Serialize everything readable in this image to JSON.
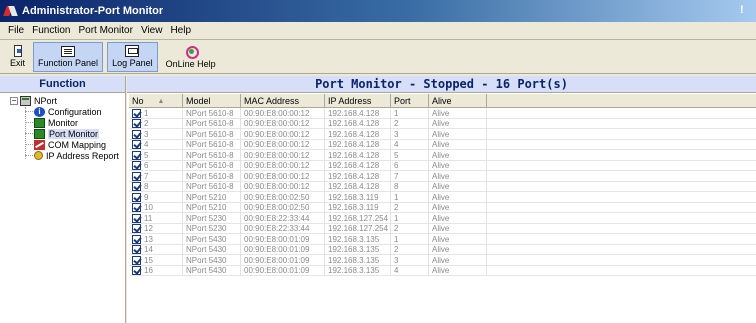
{
  "window": {
    "title": "Administrator-Port Monitor"
  },
  "menu": {
    "file": "File",
    "function": "Function",
    "port_monitor": "Port Monitor",
    "view": "View",
    "help": "Help"
  },
  "toolbar": {
    "exit": "Exit",
    "function_panel": "Function Panel",
    "log_panel": "Log Panel",
    "online_help": "OnLine Help"
  },
  "left_panel": {
    "header": "Function",
    "root": "NPort",
    "items": [
      {
        "label": "Configuration",
        "icon": "info-icon"
      },
      {
        "label": "Monitor",
        "icon": "monitor-icon"
      },
      {
        "label": "Port Monitor",
        "icon": "port-monitor-icon",
        "selected": true
      },
      {
        "label": "COM Mapping",
        "icon": "com-mapping-icon"
      },
      {
        "label": "IP Address Report",
        "icon": "ip-report-icon"
      }
    ]
  },
  "right_panel": {
    "header": "Port Monitor - Stopped - 16 Port(s)",
    "columns": [
      "No",
      "Model",
      "MAC Address",
      "IP Address",
      "Port",
      "Alive"
    ],
    "rows": [
      [
        "1",
        "NPort 5610-8",
        "00:90:E8:00:00:12",
        "192.168.4.128",
        "1",
        "Alive"
      ],
      [
        "2",
        "NPort 5610-8",
        "00:90:E8:00:00:12",
        "192.168.4.128",
        "2",
        "Alive"
      ],
      [
        "3",
        "NPort 5610-8",
        "00:90:E8:00:00:12",
        "192.168.4.128",
        "3",
        "Alive"
      ],
      [
        "4",
        "NPort 5610-8",
        "00:90:E8:00:00:12",
        "192.168.4.128",
        "4",
        "Alive"
      ],
      [
        "5",
        "NPort 5610-8",
        "00:90:E8:00:00:12",
        "192.168.4.128",
        "5",
        "Alive"
      ],
      [
        "6",
        "NPort 5610-8",
        "00:90:E8:00:00:12",
        "192.168.4.128",
        "6",
        "Alive"
      ],
      [
        "7",
        "NPort 5610-8",
        "00:90:E8:00:00:12",
        "192.168.4.128",
        "7",
        "Alive"
      ],
      [
        "8",
        "NPort 5610-8",
        "00:90:E8:00:00:12",
        "192.168.4.128",
        "8",
        "Alive"
      ],
      [
        "9",
        "NPort 5210",
        "00:90:E8:00:02:50",
        "192.168.3.119",
        "1",
        "Alive"
      ],
      [
        "10",
        "NPort 5210",
        "00:90:E8:00:02:50",
        "192.168.3.119",
        "2",
        "Alive"
      ],
      [
        "11",
        "NPort 5230",
        "00:90:E8:22:33:44",
        "192.168.127.254",
        "1",
        "Alive"
      ],
      [
        "12",
        "NPort 5230",
        "00:90:E8:22:33:44",
        "192.168.127.254",
        "2",
        "Alive"
      ],
      [
        "13",
        "NPort 5430",
        "00:90:E8:00:01:09",
        "192.168.3.135",
        "1",
        "Alive"
      ],
      [
        "14",
        "NPort 5430",
        "00:90:E8:00:01:09",
        "192.168.3.135",
        "2",
        "Alive"
      ],
      [
        "15",
        "NPort 5430",
        "00:90:E8:00:01:09",
        "192.168.3.135",
        "3",
        "Alive"
      ],
      [
        "16",
        "NPort 5430",
        "00:90:E8:00:01:09",
        "192.168.3.135",
        "4",
        "Alive"
      ]
    ]
  },
  "colors": {
    "title_start": "#0a246a",
    "title_end": "#a6caf0",
    "panel_header_bg": "#d6dff7",
    "panel_header_text": "#0a246a",
    "grid_text": "#8a8a8a"
  }
}
